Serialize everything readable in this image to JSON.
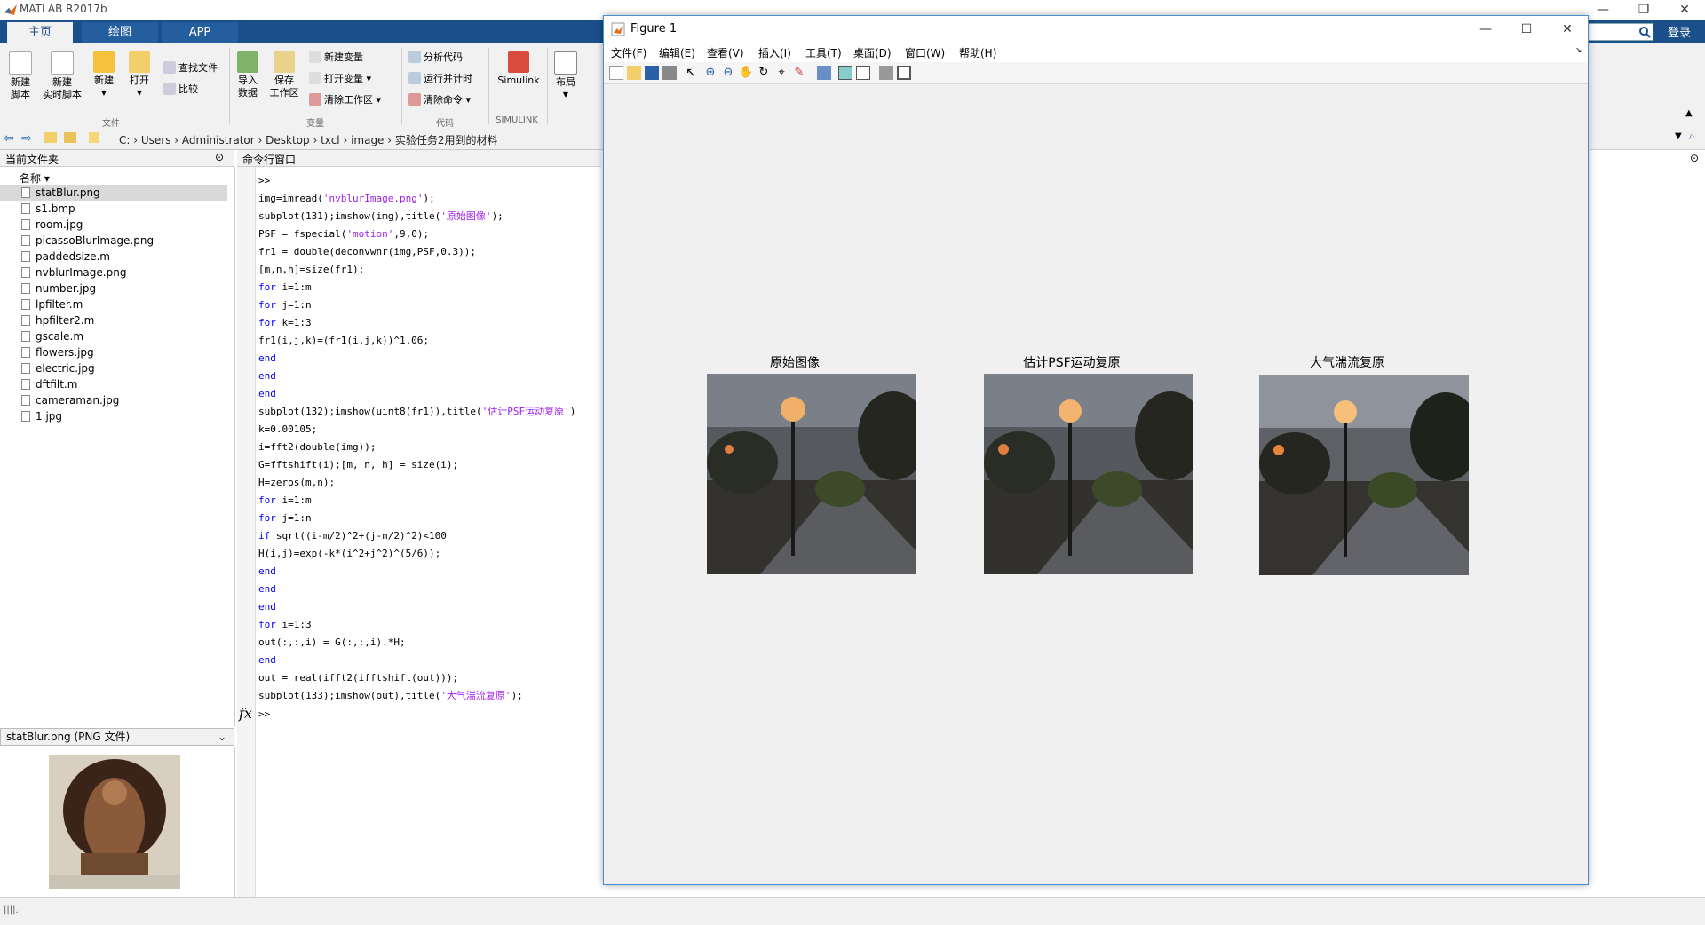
{
  "app": {
    "title": "MATLAB R2017b",
    "login": "登录"
  },
  "tabs": [
    {
      "label": "主页"
    },
    {
      "label": "绘图"
    },
    {
      "label": "APP"
    }
  ],
  "ribbon": {
    "new_script": "新建\n脚本",
    "new_live_script": "新建\n实时脚本",
    "new": "新建",
    "open": "打开",
    "find_files": "查找文件",
    "compare": "比较",
    "import_data": "导入\n数据",
    "save_workspace": "保存\n工作区",
    "new_variable": "新建变量",
    "open_variable": "打开变量",
    "clear_workspace": "清除工作区",
    "analyze_code": "分析代码",
    "run_and_time": "运行并计时",
    "clear_commands": "清除命令",
    "simulink": "Simulink",
    "layout": "布局",
    "group_file": "文件",
    "group_variable": "变量",
    "group_code": "代码",
    "group_simulink": "SIMULINK"
  },
  "address": {
    "path": [
      "C:",
      "Users",
      "Administrator",
      "Desktop",
      "txcl",
      "image",
      "实验任务2用到的材料"
    ]
  },
  "current_folder": {
    "title": "当前文件夹",
    "column": "名称",
    "files": [
      {
        "name": "statBlur.png",
        "selected": true
      },
      {
        "name": "s1.bmp"
      },
      {
        "name": "room.jpg"
      },
      {
        "name": "picassoBlurImage.png"
      },
      {
        "name": "paddedsize.m"
      },
      {
        "name": "nvblurImage.png"
      },
      {
        "name": "number.jpg"
      },
      {
        "name": "lpfilter.m"
      },
      {
        "name": "hpfilter2.m"
      },
      {
        "name": "gscale.m"
      },
      {
        "name": "flowers.jpg"
      },
      {
        "name": "electric.jpg"
      },
      {
        "name": "dftfilt.m"
      },
      {
        "name": "cameraman.jpg"
      },
      {
        "name": "1.jpg"
      }
    ]
  },
  "preview": {
    "label": "statBlur.png  (PNG 文件)"
  },
  "command_window": {
    "title": "命令行窗口",
    "prompt": ">>",
    "fx": "fx",
    "lines": [
      ">>",
      "img=imread('nvblurImage.png');",
      "subplot(131);imshow(img),title('原始图像');",
      "PSF = fspecial('motion',9,0);",
      "fr1 = double(deconvwnr(img,PSF,0.3));",
      "[m,n,h]=size(fr1);",
      "for i=1:m",
      "for j=1:n",
      "for k=1:3",
      "fr1(i,j,k)=(fr1(i,j,k))^1.06;",
      "end",
      "end",
      "end",
      "subplot(132);imshow(uint8(fr1)),title('估计PSF运动复原')",
      "k=0.00105;",
      "i=fft2(double(img));",
      "G=fftshift(i);[m, n, h] = size(i);",
      "H=zeros(m,n);",
      "for i=1:m",
      "for j=1:n",
      "if sqrt((i-m/2)^2+(j-n/2)^2)<100",
      "H(i,j)=exp(-k*(i^2+j^2)^(5/6));",
      "end",
      "end",
      "end",
      "for i=1:3",
      "out(:,:,i) = G(:,:,i).*H;",
      "end",
      "out = real(ifft2(ifftshift(out)));",
      "subplot(133);imshow(out),title('大气湍流复原');"
    ]
  },
  "figure": {
    "title": "Figure 1",
    "menu": [
      "文件(F)",
      "编辑(E)",
      "查看(V)",
      "插入(I)",
      "工具(T)",
      "桌面(D)",
      "窗口(W)",
      "帮助(H)"
    ],
    "axes": [
      {
        "title": "原始图像"
      },
      {
        "title": "估计PSF运动复原"
      },
      {
        "title": "大气湍流复原"
      }
    ]
  },
  "colors": {
    "ribbon_tab_bg": "#1b4f8a",
    "figure_border": "#4a8bd6",
    "keyword": "#0000ff",
    "string": "#a020f0"
  }
}
